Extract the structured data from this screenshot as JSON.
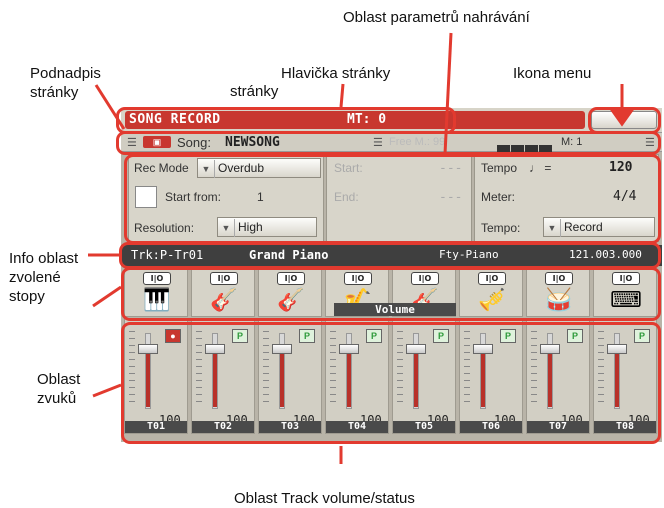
{
  "callouts": {
    "param_area": "Oblast parametrů nahrávání",
    "subtitle_1": "Podnadpis",
    "subtitle_2": "stránky",
    "page_header": "Hlavička stránky",
    "page_header_2": "stránky",
    "menu_icon": "Ikona menu",
    "info_1": "Info oblast",
    "info_2": "zvolené",
    "info_3": "stopy",
    "sounds_1": "Oblast",
    "sounds_2": "zvuků",
    "track_area": "Oblast Track volume/status"
  },
  "header": {
    "title": "SONG RECORD",
    "mt": "MT: 0"
  },
  "subheader": {
    "song_label": "Song:",
    "song_name": "NEWSONG",
    "free": "Free M.: 99",
    "measure": "M: 1"
  },
  "params": {
    "rec_mode_label": "Rec Mode",
    "rec_mode_value": "Overdub",
    "start_from_label": "Start from:",
    "start_from_value": "1",
    "resolution_label": "Resolution:",
    "resolution_value": "High",
    "start_label": "Start:",
    "start_value": "---",
    "end_label": "End:",
    "end_value": "---",
    "tempo_label": "Tempo",
    "tempo_note": "♩ =",
    "tempo_value": "120",
    "meter_label": "Meter:",
    "meter_value": "4/4",
    "tempo_mode_label": "Tempo:",
    "tempo_mode_value": "Record"
  },
  "info": {
    "track": "Trk:P-Tr01",
    "sound": "Grand Piano",
    "bank": "Fty-Piano",
    "position": "121.003.000"
  },
  "sounds": [
    {
      "io": "I|O",
      "icon": "grand-piano-icon"
    },
    {
      "io": "I|O",
      "icon": "electric-guitar-icon"
    },
    {
      "io": "I|O",
      "icon": "acoustic-guitar-icon"
    },
    {
      "io": "I|O",
      "icon": "saxophone-icon"
    },
    {
      "io": "I|O",
      "icon": "acoustic-guitar-icon"
    },
    {
      "io": "I|O",
      "icon": "brass-icon"
    },
    {
      "io": "I|O",
      "icon": "drums-icon"
    },
    {
      "io": "I|O",
      "icon": "keyboard-icon"
    }
  ],
  "volume": {
    "title": "Volume",
    "tracks": [
      {
        "name": "T01",
        "value": "100",
        "status": "rec"
      },
      {
        "name": "T02",
        "value": "100",
        "status": "P"
      },
      {
        "name": "T03",
        "value": "100",
        "status": "P"
      },
      {
        "name": "T04",
        "value": "100",
        "status": "P"
      },
      {
        "name": "T05",
        "value": "100",
        "status": "P"
      },
      {
        "name": "T06",
        "value": "100",
        "status": "P"
      },
      {
        "name": "T07",
        "value": "100",
        "status": "P"
      },
      {
        "name": "T08",
        "value": "100",
        "status": "P"
      }
    ]
  },
  "colors": {
    "highlight": "#e23a2f",
    "rec": "#c8372f",
    "play": "#2e9a3a"
  }
}
